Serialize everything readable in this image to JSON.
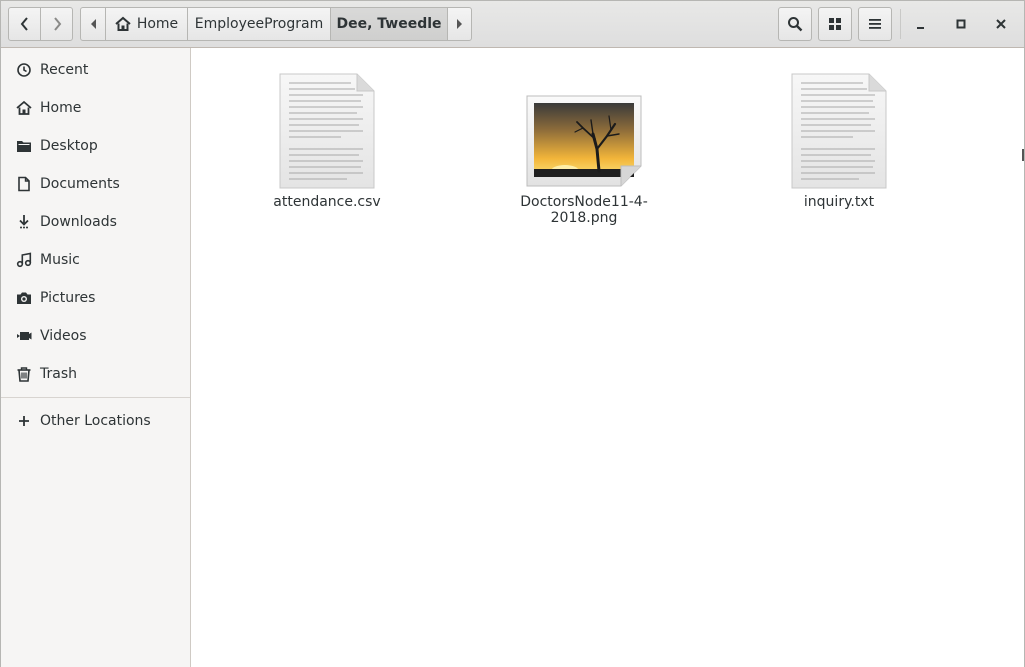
{
  "header": {
    "breadcrumbs": [
      "Home",
      "EmployeeProgram",
      "Dee, Tweedle"
    ],
    "buttons": {
      "back": "back-icon",
      "forward": "forward-icon",
      "search": "search-icon",
      "view": "grid-view-icon",
      "menu": "hamburger-menu-icon",
      "minimize": "minimize-icon",
      "maximize": "maximize-icon",
      "close": "close-icon"
    }
  },
  "sidebar": {
    "items": [
      {
        "label": "Recent",
        "icon": "clock-icon"
      },
      {
        "label": "Home",
        "icon": "home-icon"
      },
      {
        "label": "Desktop",
        "icon": "folder-icon"
      },
      {
        "label": "Documents",
        "icon": "document-icon"
      },
      {
        "label": "Downloads",
        "icon": "download-icon"
      },
      {
        "label": "Music",
        "icon": "music-icon"
      },
      {
        "label": "Pictures",
        "icon": "camera-icon"
      },
      {
        "label": "Videos",
        "icon": "video-icon"
      },
      {
        "label": "Trash",
        "icon": "trash-icon"
      },
      {
        "label": "Other Locations",
        "icon": "plus-icon"
      }
    ]
  },
  "files": [
    {
      "name": "attendance.csv",
      "icon": "text-file-icon"
    },
    {
      "name": "DoctorsNode11-4-2018.png",
      "icon": "image-file-icon"
    },
    {
      "name": "inquiry.txt",
      "icon": "text-file-icon"
    }
  ]
}
